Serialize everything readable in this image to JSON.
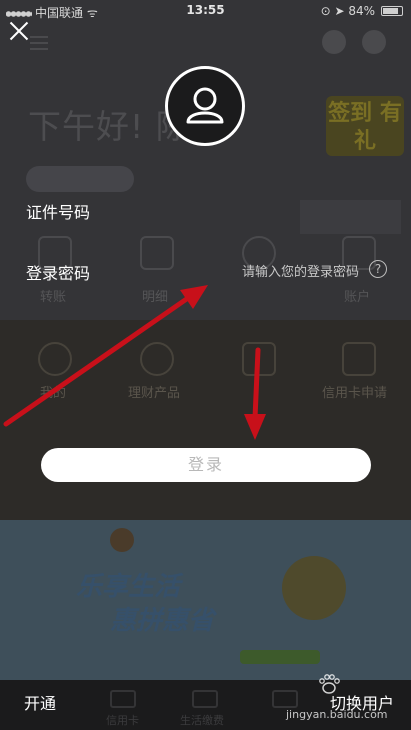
{
  "status_bar": {
    "carrier": "中国联通",
    "time": "13:55",
    "battery": "84%",
    "battery_level": 0.84
  },
  "background_app": {
    "greeting": "下午好! 陈",
    "sign_badge": "签到 有礼",
    "row1_labels": [
      "转账",
      "明细",
      "",
      "账户"
    ],
    "row2_labels": [
      "我的",
      "理财产品",
      "",
      "信用卡申请"
    ],
    "banner_line1": "乐享生活",
    "banner_line2": "惠拼惠省",
    "tab_labels": [
      "",
      "信用卡",
      "生活缴费",
      "",
      ""
    ]
  },
  "login_sheet": {
    "id_label": "证件号码",
    "password_label": "登录密码",
    "password_placeholder": "请输入您的登录密码",
    "help_icon_text": "?",
    "login_button": "登录",
    "bottom_left": "开通",
    "bottom_right": "切换用户"
  },
  "watermark": {
    "brand": "Bai 经验",
    "url": "jingyan.baidu.com"
  },
  "colors": {
    "annotation_arrow": "#c8101a",
    "button_bg": "#ffffff",
    "overlay": "#1f1f21"
  }
}
